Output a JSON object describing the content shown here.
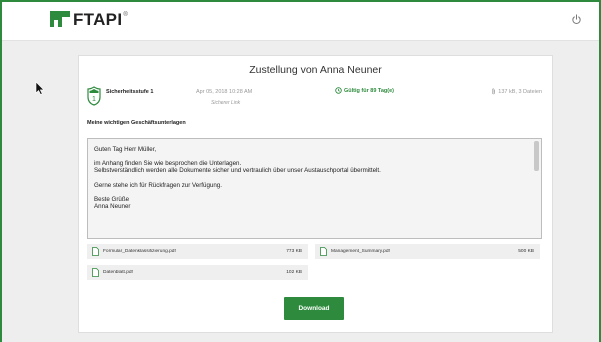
{
  "header": {
    "logo_text": "FTAPI",
    "logo_reg": "®"
  },
  "card": {
    "title": "Zustellung von Anna Neuner",
    "security_label": "Sicherheitsstufe 1",
    "security_level": "1",
    "date": "Apr 05, 2018 10:28 AM",
    "link_type": "Sicherer Link",
    "validity": "Gültig für 89 Tag(e)",
    "size_info": "137 kB, 3 Dateien",
    "subject": "Meine wichtigen Geschäftsunterlagen",
    "message": {
      "greeting": "Guten Tag Herr Müller,",
      "line1": "im Anhang finden Sie wie besprochen die Unterlagen.",
      "line2": "Selbstverständlich werden alle Dokumente sicher und vertraulich über unser Austauschportal übermittelt.",
      "line3": "Gerne stehe ich für Rückfragen zur Verfügung.",
      "closing": "Beste Grüße",
      "signature": "Anna Neuner"
    },
    "files": [
      {
        "name": "Formular_Datenklassifizierung.pdf",
        "size": "773 KB"
      },
      {
        "name": "Management_Summary.pdf",
        "size": "500 KB"
      },
      {
        "name": "Datenblatt.pdf",
        "size": "102 KB"
      }
    ],
    "download_label": "Download"
  },
  "colors": {
    "brand": "#2e8b3e",
    "background": "#eeeeee"
  },
  "icons": [
    "power-icon",
    "shield-icon",
    "clock-icon",
    "paperclip-icon",
    "file-icon",
    "cursor-icon"
  ]
}
